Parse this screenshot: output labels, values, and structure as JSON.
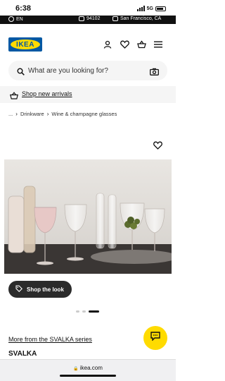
{
  "status_bar": {
    "time": "6:38",
    "network": "5G"
  },
  "top_strip": {
    "language": "EN",
    "zip": "94102",
    "store": "San Francisco, CA"
  },
  "header": {
    "logo_text": "IKEA"
  },
  "search": {
    "placeholder": "What are you looking for?"
  },
  "banner": {
    "arrivals_label": "Shop new arrivals"
  },
  "breadcrumb": {
    "ellipsis": "...",
    "items": [
      "Drinkware",
      "Wine & champagne glasses"
    ]
  },
  "product": {
    "shop_look_label": "Shop the look",
    "series_link": "More from the SVALKA series",
    "name": "SVALKA",
    "carousel": {
      "total": 3,
      "active": 3
    }
  },
  "browser": {
    "url": "ikea.com"
  },
  "colors": {
    "ikea_blue": "#0058a3",
    "ikea_yellow": "#ffdb00",
    "dark_button": "#2b2b2b"
  }
}
